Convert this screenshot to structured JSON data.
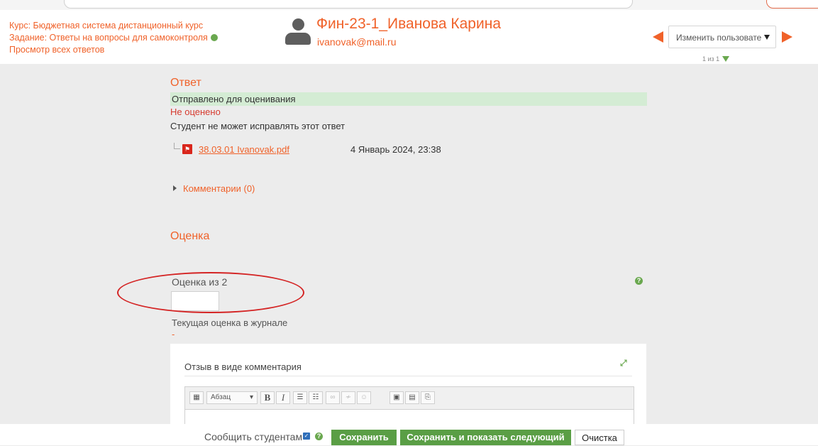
{
  "header": {
    "course_link": "Курс: Бюджетная система дистанционный курс",
    "assignment_link": "Задание: Ответы на вопросы для самоконтроля",
    "view_all_link": "Просмотр всех ответов",
    "user_name": "Фин-23-1_Иванова Карина",
    "user_email": "ivanovak@mail.ru",
    "change_user_select": "Изменить пользовате",
    "pager": "1 из 1"
  },
  "submission": {
    "heading": "Ответ",
    "status": "Отправлено для оценивания",
    "grading_status": "Не оценено",
    "edit_status": "Студент не может исправлять этот ответ",
    "file_name": "38.03.01 Ivanovak.pdf",
    "file_date": "4 Январь 2024, 23:38",
    "comments_link": "Комментарии (0)"
  },
  "grade": {
    "heading": "Оценка",
    "grade_label": "Оценка из 2",
    "grade_value": "",
    "current_grade_label": "Текущая оценка в журнале",
    "current_grade_value": "-"
  },
  "feedback": {
    "title": "Отзыв в виде комментария",
    "paragraph_select": "Абзац",
    "bold": "B",
    "italic": "I"
  },
  "footer": {
    "notify_label": "Сообщить студентам",
    "save_button": "Сохранить",
    "save_next_button": "Сохранить и показать следующий",
    "clear_button": "Очистка"
  },
  "colors": {
    "accent": "#f0622a",
    "status_bg": "#d4ecd4",
    "error": "#d63b2f",
    "button_green": "#5a9e45",
    "annotation_oval": "#d42424"
  }
}
